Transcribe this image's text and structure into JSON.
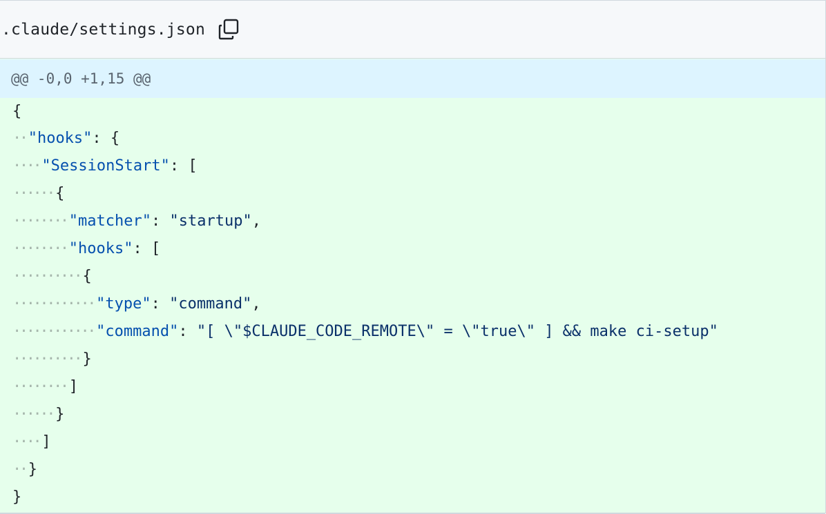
{
  "file": {
    "name": ".claude/settings.json",
    "copy_icon": "copy-icon"
  },
  "hunk": {
    "header": "@@ -0,0 +1,15 @@"
  },
  "code_lines": [
    {
      "indent": 0,
      "parts": [
        [
          "punc",
          "{"
        ]
      ]
    },
    {
      "indent": 2,
      "parts": [
        [
          "prop",
          "\"hooks\""
        ],
        [
          "punc",
          ": {"
        ]
      ]
    },
    {
      "indent": 4,
      "parts": [
        [
          "prop",
          "\"SessionStart\""
        ],
        [
          "punc",
          ": ["
        ]
      ]
    },
    {
      "indent": 6,
      "parts": [
        [
          "punc",
          "{"
        ]
      ]
    },
    {
      "indent": 8,
      "parts": [
        [
          "prop",
          "\"matcher\""
        ],
        [
          "punc",
          ": "
        ],
        [
          "str",
          "\"startup\""
        ],
        [
          "punc",
          ","
        ]
      ]
    },
    {
      "indent": 8,
      "parts": [
        [
          "prop",
          "\"hooks\""
        ],
        [
          "punc",
          ": ["
        ]
      ]
    },
    {
      "indent": 10,
      "parts": [
        [
          "punc",
          "{"
        ]
      ]
    },
    {
      "indent": 12,
      "parts": [
        [
          "prop",
          "\"type\""
        ],
        [
          "punc",
          ": "
        ],
        [
          "str",
          "\"command\""
        ],
        [
          "punc",
          ","
        ]
      ]
    },
    {
      "indent": 12,
      "parts": [
        [
          "prop",
          "\"command\""
        ],
        [
          "punc",
          ": "
        ],
        [
          "str",
          "\"[ \\\"$CLAUDE_CODE_REMOTE\\\" = \\\"true\\\" ] && make ci-setup\""
        ]
      ]
    },
    {
      "indent": 10,
      "parts": [
        [
          "punc",
          "}"
        ]
      ]
    },
    {
      "indent": 8,
      "parts": [
        [
          "punc",
          "]"
        ]
      ]
    },
    {
      "indent": 6,
      "parts": [
        [
          "punc",
          "}"
        ]
      ]
    },
    {
      "indent": 4,
      "parts": [
        [
          "punc",
          "]"
        ]
      ]
    },
    {
      "indent": 2,
      "parts": [
        [
          "punc",
          "}"
        ]
      ]
    },
    {
      "indent": 0,
      "parts": [
        [
          "punc",
          "}"
        ]
      ]
    }
  ],
  "colors": {
    "added_bg": "#e6ffec",
    "hunk_bg": "#ddf4ff",
    "header_bg": "#f6f8fa",
    "key": "#0550ae",
    "string": "#0a3069"
  }
}
